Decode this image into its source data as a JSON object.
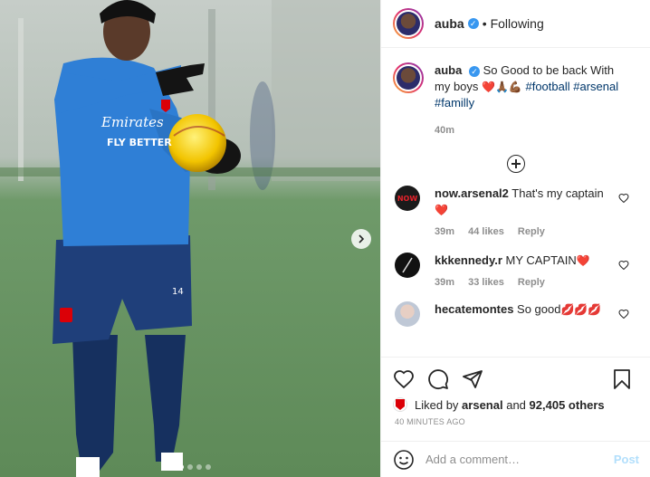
{
  "header": {
    "username": "auba",
    "separator": "•",
    "follow_state": "Following"
  },
  "caption": {
    "username": "auba",
    "text": "So Good to be back With my boys",
    "emojis": "❤️🙏🏾💪🏾",
    "hashtags": [
      "#football",
      "#arsenal",
      "#familly"
    ],
    "time": "40m"
  },
  "comments": [
    {
      "username": "now.arsenal2",
      "text": "That's my captain",
      "emoji": "❤️",
      "time": "39m",
      "likes": "44 likes",
      "reply": "Reply"
    },
    {
      "username": "kkkennedy.r",
      "text": "MY CAPTAIN",
      "emoji": "❤️",
      "time": "39m",
      "likes": "33 likes",
      "reply": "Reply"
    },
    {
      "username": "hecatemontes",
      "text": "So good",
      "emoji": "💋💋💋"
    }
  ],
  "likes": {
    "prefix": "Liked by",
    "by": "arsenal",
    "joiner": "and",
    "count": "92,405 others"
  },
  "time_ago": "40 MINUTES AGO",
  "add_comment": {
    "placeholder": "Add a comment…",
    "post_label": "Post"
  },
  "media": {
    "sponsor_text_1": "Emirates",
    "sponsor_text_2": "FLY BETTER",
    "shorts_number": "14",
    "carousel_dots": 5,
    "active_dot": 2
  },
  "avatars": {
    "now_arsenal_text": "NOW"
  },
  "colors": {
    "verified": "#3897f0",
    "hashtag": "#00376b",
    "heart": "#ed4956",
    "post_disabled": "#b2dffc",
    "shirt": "#2f7fd6"
  }
}
